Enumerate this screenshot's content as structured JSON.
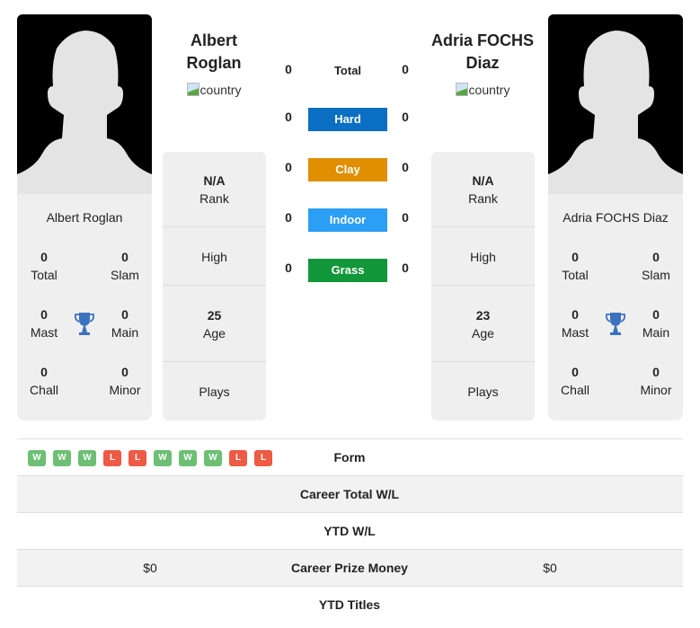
{
  "colors": {
    "hard": "#0a6fc2",
    "clay": "#df8f00",
    "indoor": "#2b9ef5",
    "grass": "#11963a",
    "win": "#6cbf73",
    "loss": "#ee5a44",
    "trophy": "#3a72bf"
  },
  "player1": {
    "name": "Albert Roglan",
    "name_line1": "Albert",
    "name_line2": "Roglan",
    "country_alt": "country",
    "titles": {
      "total": {
        "value": "0",
        "label": "Total"
      },
      "slam": {
        "value": "0",
        "label": "Slam"
      },
      "mast": {
        "value": "0",
        "label": "Mast"
      },
      "main": {
        "value": "0",
        "label": "Main"
      },
      "chall": {
        "value": "0",
        "label": "Chall"
      },
      "minor": {
        "value": "0",
        "label": "Minor"
      }
    },
    "info": {
      "rank": {
        "value": "N/A",
        "label": "Rank"
      },
      "high": {
        "label": "High"
      },
      "age": {
        "value": "25",
        "label": "Age"
      },
      "plays": {
        "label": "Plays"
      }
    }
  },
  "player2": {
    "name": "Adria FOCHS Diaz",
    "name_line1": "Adria FOCHS",
    "name_line2": "Diaz",
    "country_alt": "country",
    "titles": {
      "total": {
        "value": "0",
        "label": "Total"
      },
      "slam": {
        "value": "0",
        "label": "Slam"
      },
      "mast": {
        "value": "0",
        "label": "Mast"
      },
      "main": {
        "value": "0",
        "label": "Main"
      },
      "chall": {
        "value": "0",
        "label": "Chall"
      },
      "minor": {
        "value": "0",
        "label": "Minor"
      }
    },
    "info": {
      "rank": {
        "value": "N/A",
        "label": "Rank"
      },
      "high": {
        "label": "High"
      },
      "age": {
        "value": "23",
        "label": "Age"
      },
      "plays": {
        "label": "Plays"
      }
    }
  },
  "surfaces": [
    {
      "label": "Total",
      "p1": "0",
      "p2": "0"
    },
    {
      "label": "Hard",
      "p1": "0",
      "p2": "0"
    },
    {
      "label": "Clay",
      "p1": "0",
      "p2": "0"
    },
    {
      "label": "Indoor",
      "p1": "0",
      "p2": "0"
    },
    {
      "label": "Grass",
      "p1": "0",
      "p2": "0"
    }
  ],
  "form": {
    "label": "Form",
    "p1": [
      "W",
      "W",
      "W",
      "L",
      "L",
      "W",
      "W",
      "W",
      "L",
      "L"
    ]
  },
  "table": [
    {
      "label": "Career Total W/L",
      "p1": "",
      "p2": ""
    },
    {
      "label": "YTD W/L",
      "p1": "",
      "p2": ""
    },
    {
      "label": "Career Prize Money",
      "p1": "$0",
      "p2": "$0"
    },
    {
      "label": "YTD Titles",
      "p1": "",
      "p2": ""
    }
  ]
}
